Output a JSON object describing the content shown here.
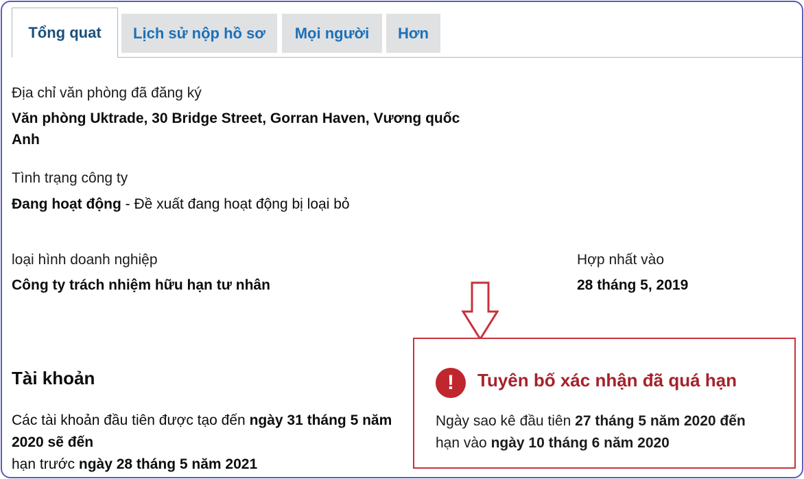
{
  "tabs": [
    {
      "label": "Tổng quat",
      "active": true
    },
    {
      "label": "Lịch sử nộp hồ sơ",
      "active": false
    },
    {
      "label": "Mọi người",
      "active": false
    },
    {
      "label": "Hơn",
      "active": false
    }
  ],
  "registered_office": {
    "label": "Địa chỉ văn phòng đã đăng ký",
    "value_line1": "Văn phòng Uktrade, 30 Bridge Street, Gorran Haven, Vương quốc",
    "value_line2": "Anh"
  },
  "company_status": {
    "label": "Tình trạng công ty",
    "value_bold": "Đang hoạt động",
    "value_rest": " - Đề xuất đang hoạt động bị loại bỏ"
  },
  "company_type": {
    "label": "loại hình doanh nghiệp",
    "value": "Công ty trách nhiệm hữu hạn tư nhân"
  },
  "incorporated": {
    "label": "Hợp nhất vào",
    "value": "28 tháng 5, 2019"
  },
  "accounts": {
    "heading": "Tài khoản",
    "text1": "Các tài khoản đầu tiên được tạo đến ",
    "bold1": "ngày 31 tháng 5 năm 2020 sẽ đến",
    "text2": "hạn trước ",
    "bold2": "ngày 28 tháng 5 năm 2021"
  },
  "alert": {
    "icon": "!",
    "title": "Tuyên bố xác nhận đã quá hạn",
    "text1": "Ngày sao kê đầu tiên ",
    "bold1": "27 tháng 5 năm 2020 đến",
    "text2": "hạn vào ",
    "bold2": "ngày 10 tháng 6 năm 2020"
  },
  "colors": {
    "frame": "#5a5cb4",
    "alert_border": "#c8313b",
    "alert_icon": "#c0262e",
    "arrow": "#c8313b",
    "tab_link": "#1d70b8"
  }
}
